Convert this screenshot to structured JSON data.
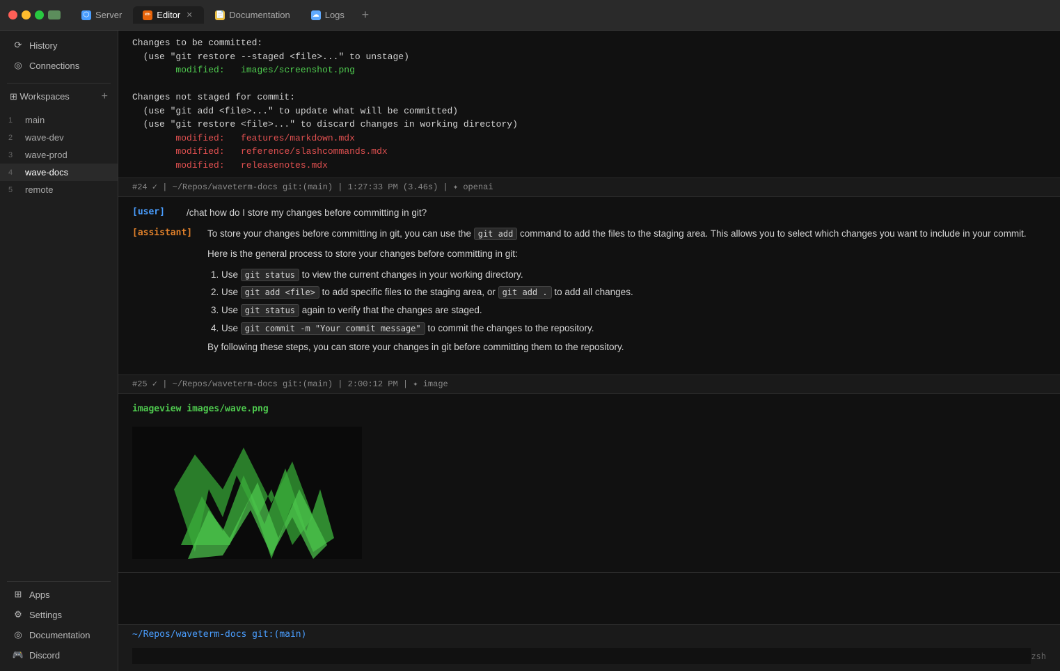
{
  "titlebar": {
    "tabs": [
      {
        "id": "server",
        "label": "Server",
        "icon_type": "server",
        "active": false
      },
      {
        "id": "editor",
        "label": "Editor",
        "icon_type": "editor",
        "active": true
      },
      {
        "id": "documentation",
        "label": "Documentation",
        "icon_type": "docs",
        "active": false
      },
      {
        "id": "logs",
        "label": "Logs",
        "icon_type": "logs",
        "active": false
      }
    ],
    "add_tab_label": "+"
  },
  "sidebar": {
    "history_label": "History",
    "connections_label": "Connections",
    "workspaces_label": "Workspaces",
    "workspaces_add": "+",
    "workspace_items": [
      {
        "num": "1",
        "label": "main",
        "active": false
      },
      {
        "num": "2",
        "label": "wave-dev",
        "active": false
      },
      {
        "num": "3",
        "label": "wave-prod",
        "active": false
      },
      {
        "num": "4",
        "label": "wave-docs",
        "active": true
      },
      {
        "num": "5",
        "label": "remote",
        "active": false
      }
    ],
    "apps_label": "Apps",
    "settings_label": "Settings",
    "documentation_label": "Documentation",
    "discord_label": "Discord"
  },
  "terminal": {
    "block1": {
      "lines": [
        "Changes to be committed:",
        "  (use \"git restore --staged <file>...\" to unstage)",
        "        modified:   images/screenshot.png",
        "",
        "Changes not staged for commit:",
        "  (use \"git add <file>...\" to update what will be committed)",
        "  (use \"git restore <file>...\" to discard changes in working directory)",
        "        modified:   features/markdown.mdx",
        "        modified:   reference/slashcommands.mdx",
        "        modified:   releasenotes.mdx"
      ]
    },
    "block2_status": "#24 ✓  |  ~/Repos/waveterm-docs  git:(main)  |  1:27:33 PM (3.46s)  |  ✦ openai",
    "block2_user": "/chat how do I store my changes before committing in git?",
    "block2_assistant_intro": "To store your changes before committing in git, you can use the ",
    "block2_code1": "git add",
    "block2_assistant_intro2": " command to add the files to the staging area. This allows you to select which changes you want to include in your commit.",
    "block2_general_process": "Here is the general process to store your changes before committing in git:",
    "block2_steps": [
      {
        "num": "1",
        "text_before": "Use ",
        "code": "git status",
        "text_after": " to view the current changes in your working directory."
      },
      {
        "num": "2",
        "text_before": "Use ",
        "code": "git add <file>",
        "text_after": " to add specific files to the staging area, or ",
        "code2": "git add .",
        "text_after2": " to add all changes."
      },
      {
        "num": "3",
        "text_before": "Use ",
        "code": "git status",
        "text_after": " again to verify that the changes are staged."
      },
      {
        "num": "4",
        "text_before": "Use ",
        "code": "git commit -m \"Your commit message\"",
        "text_after": " to commit the changes to the repository."
      }
    ],
    "block2_closing": "By following these steps, you can store your changes in git before committing them to the repository.",
    "block3_status": "#25 ✓  |  ~/Repos/waveterm-docs  git:(main)  |  2:00:12 PM  |  ✦ image",
    "block3_cmd": "imageview images/wave.png",
    "bottom_prompt": "~/Repos/waveterm-docs  git:(main)",
    "zsh_label": "zsh"
  }
}
